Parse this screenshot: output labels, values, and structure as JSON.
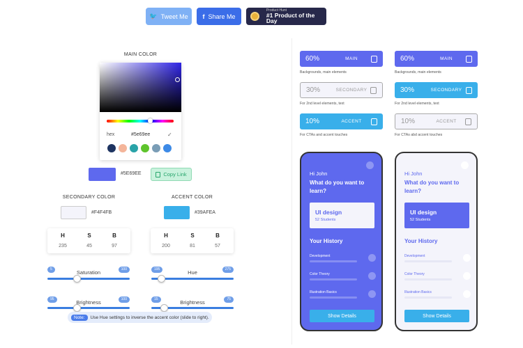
{
  "top_buttons": {
    "tweet": "Tweet Me",
    "share": "Share Me",
    "producthunt_small": "Product Hunt",
    "producthunt_big": "#1 Product of the Day"
  },
  "main_color": {
    "label": "MAIN COLOR",
    "hex_label": "hex",
    "hex_value": "#5e69ee",
    "display_hex": "#5E69EE",
    "copy_label": "Copy Link",
    "swatches": [
      "#1e3461",
      "#f4b59a",
      "#29a3a8",
      "#5ec42c",
      "#7a9db6",
      "#3d8ae6"
    ]
  },
  "secondary_color": {
    "label": "SECONDARY COLOR",
    "hex": "#F4F4FB",
    "hsb": {
      "H": "235",
      "S": "45",
      "B": "97"
    }
  },
  "accent_color": {
    "label": "ACCENT COLOR",
    "hex": "#39AFEA",
    "hsb": {
      "H": "200",
      "S": "81",
      "B": "57"
    }
  },
  "hsb_keys": {
    "h": "H",
    "s": "S",
    "b": "B"
  },
  "sliders": {
    "saturation": {
      "label": "Saturation",
      "min": "5",
      "max": "100",
      "value": 0.35
    },
    "hue": {
      "label": "Hue",
      "min": "195",
      "max": "275",
      "value": 0.08
    },
    "brightness_left": {
      "label": "Brightness",
      "min": "95",
      "max": "100",
      "value": 0.35
    },
    "brightness_right": {
      "label": "Brightness",
      "min": "15",
      "max": "75",
      "value": 0.12
    }
  },
  "note": {
    "tag": "Note:",
    "text": "Use Hue settings to inverse the accent color (slide to right)."
  },
  "palette_left": [
    {
      "pct": "60%",
      "name": "MAIN",
      "desc": "Backgrounds, main elements"
    },
    {
      "pct": "30%",
      "name": "SECONDARY",
      "desc": "For 2nd level elements, text"
    },
    {
      "pct": "10%",
      "name": "ACCENT",
      "desc": "For CTAs and accent touches"
    }
  ],
  "palette_right": [
    {
      "pct": "60%",
      "name": "MAIN",
      "desc": "Backgrounds, main elements"
    },
    {
      "pct": "30%",
      "name": "SECONDARY",
      "desc": "For 2nd level elements, text"
    },
    {
      "pct": "10%",
      "name": "ACCENT",
      "desc": "For CTAs abd accent touches"
    }
  ],
  "phone": {
    "greeting": "Hi John",
    "question": "What do you want to learn?",
    "card_title": "UI design",
    "card_sub": "52 Students",
    "history": "Your History",
    "rows": [
      "Development",
      "Color Theory",
      "Illustration Basics"
    ],
    "button": "Show Details"
  }
}
